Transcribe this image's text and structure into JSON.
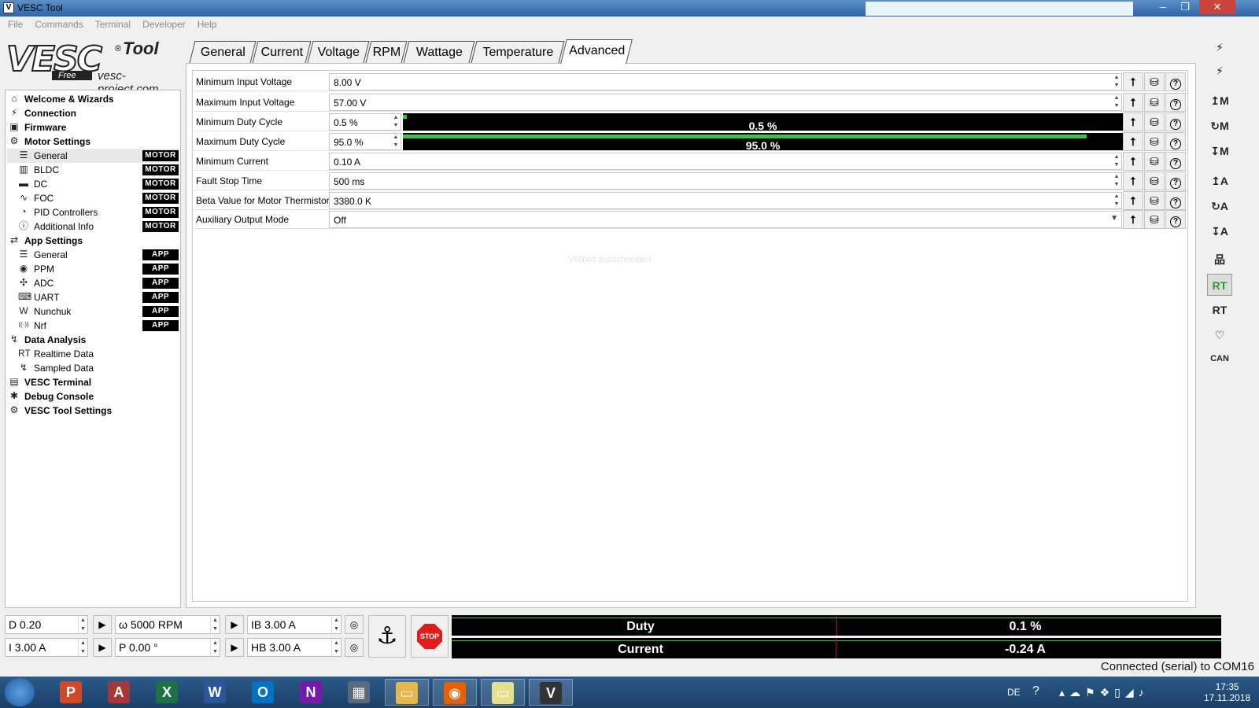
{
  "window": {
    "title": "VESC Tool",
    "icon": "V"
  },
  "menu": [
    "File",
    "Commands",
    "Terminal",
    "Developer",
    "Help"
  ],
  "logo": {
    "brand": "VESC",
    "product": "Tool",
    "reg": "®",
    "edition": "Free",
    "site": "vesc-project.com"
  },
  "tree": [
    {
      "label": "Welcome & Wizards",
      "icon": "home-icon",
      "glyph": "⌂",
      "level": 0
    },
    {
      "label": "Connection",
      "icon": "plug-icon",
      "glyph": "⚡",
      "level": 0
    },
    {
      "label": "Firmware",
      "icon": "chip-icon",
      "glyph": "▣",
      "level": 0
    },
    {
      "label": "Motor Settings",
      "icon": "motor-icon",
      "glyph": "⚙",
      "level": 0
    },
    {
      "label": "General",
      "icon": "sliders-icon",
      "glyph": "☰",
      "level": 1,
      "tag": "MOTOR",
      "selected": true
    },
    {
      "label": "BLDC",
      "icon": "bldc-icon",
      "glyph": "▥",
      "level": 1,
      "tag": "MOTOR"
    },
    {
      "label": "DC",
      "icon": "battery-icon",
      "glyph": "▬",
      "level": 1,
      "tag": "MOTOR"
    },
    {
      "label": "FOC",
      "icon": "coil-icon",
      "glyph": "∿",
      "level": 1,
      "tag": "MOTOR"
    },
    {
      "label": "PID Controllers",
      "icon": "gauge-icon",
      "glyph": "◔",
      "level": 1,
      "tag": "MOTOR"
    },
    {
      "label": "Additional Info",
      "icon": "info-icon",
      "glyph": "ⓘ",
      "level": 1,
      "tag": "MOTOR"
    },
    {
      "label": "App Settings",
      "icon": "swap-icon",
      "glyph": "⇄",
      "level": 0
    },
    {
      "label": "General",
      "icon": "sliders-icon",
      "glyph": "☰",
      "level": 1,
      "tag": "APP"
    },
    {
      "label": "PPM",
      "icon": "gamepad-icon",
      "glyph": "◉",
      "level": 1,
      "tag": "APP"
    },
    {
      "label": "ADC",
      "icon": "adc-icon",
      "glyph": "✣",
      "level": 1,
      "tag": "APP"
    },
    {
      "label": "UART",
      "icon": "keyboard-icon",
      "glyph": "⌨",
      "level": 1,
      "tag": "APP"
    },
    {
      "label": "Nunchuk",
      "icon": "wii-icon",
      "glyph": "W",
      "level": 1,
      "tag": "APP"
    },
    {
      "label": "Nrf",
      "icon": "wireless-icon",
      "glyph": "((·))",
      "level": 1,
      "tag": "APP"
    },
    {
      "label": "Data Analysis",
      "icon": "chart-icon",
      "glyph": "↯",
      "level": 0
    },
    {
      "label": "Realtime Data",
      "icon": "realtime-icon",
      "glyph": "RT",
      "level": 1
    },
    {
      "label": "Sampled Data",
      "icon": "sampled-icon",
      "glyph": "↯",
      "level": 1
    },
    {
      "label": "VESC Terminal",
      "icon": "terminal-icon",
      "glyph": "▤",
      "level": 0
    },
    {
      "label": "Debug Console",
      "icon": "bug-icon",
      "glyph": "✱",
      "level": 0
    },
    {
      "label": "VESC Tool Settings",
      "icon": "gear-icon",
      "glyph": "⚙",
      "level": 0
    }
  ],
  "tabs": [
    "General",
    "Current",
    "Voltage",
    "RPM",
    "Wattage",
    "Temperature",
    "Advanced"
  ],
  "active_tab": "Advanced",
  "params": [
    {
      "label": "Minimum Input Voltage",
      "value": "8.00 V",
      "kind": "spin"
    },
    {
      "label": "Maximum Input Voltage",
      "value": "57.00 V",
      "kind": "spin"
    },
    {
      "label": "Minimum Duty Cycle",
      "value": "0.5 %",
      "kind": "bar",
      "bar_text": "0.5 %",
      "fraction": 0.005
    },
    {
      "label": "Maximum Duty Cycle",
      "value": "95.0 %",
      "kind": "bar",
      "bar_text": "95.0 %",
      "fraction": 0.95
    },
    {
      "label": "Minimum Current",
      "value": "0.10 A",
      "kind": "spin"
    },
    {
      "label": "Fault Stop Time",
      "value": "500 ms",
      "kind": "spin"
    },
    {
      "label": "Beta Value for Motor Thermistor",
      "value": "3380.0 K",
      "kind": "spin"
    },
    {
      "label": "Auxiliary Output Mode",
      "value": "Off",
      "kind": "select"
    }
  ],
  "param_buttons": {
    "upload": "⭡",
    "default": "⛁",
    "help": "?"
  },
  "watermark": "Vollbild ausschneiden",
  "right_toolbar": [
    {
      "name": "connect-icon",
      "glyph": "⚡"
    },
    {
      "name": "disconnect-icon",
      "glyph": "⚡"
    },
    {
      "name": "read-motor-config-icon",
      "glyph": "↥M"
    },
    {
      "name": "read-default-motor-config-icon",
      "glyph": "↻M"
    },
    {
      "name": "write-motor-config-icon",
      "glyph": "↧M"
    },
    {
      "name": "read-app-config-icon",
      "glyph": "↥A"
    },
    {
      "name": "read-default-app-config-icon",
      "glyph": "↻A"
    },
    {
      "name": "write-app-config-icon",
      "glyph": "↧A"
    },
    {
      "name": "can-network-icon",
      "glyph": "品"
    },
    {
      "name": "realtime-data-icon",
      "glyph": "RT",
      "active": true
    },
    {
      "name": "realtime-app-icon",
      "glyph": "RT"
    },
    {
      "name": "heartbeat-icon",
      "glyph": "♡"
    },
    {
      "name": "can-fwd-icon",
      "glyph": "CAN"
    }
  ],
  "controls": {
    "duty": "D 0.20",
    "current": "I 3.00 A",
    "rpm": "ω 5000 RPM",
    "position": "P 0.00 °",
    "brake_current": "IB 3.00 A",
    "handbrake": "HB 3.00 A",
    "play": "▶",
    "brake": "◎",
    "anchor": "⚓",
    "stop": "STOP"
  },
  "gauges": [
    {
      "name": "Duty",
      "value": "0.1 %",
      "fraction": 0.001
    },
    {
      "name": "Current",
      "value": "-0.24 A",
      "fraction": -0.002
    }
  ],
  "status": "Connected (serial) to COM16",
  "taskbar": {
    "apps": [
      {
        "name": "powerpoint-icon",
        "glyph": "P",
        "color": "#d24726"
      },
      {
        "name": "access-icon",
        "glyph": "A",
        "color": "#a4373a"
      },
      {
        "name": "excel-icon",
        "glyph": "X",
        "color": "#1e7145"
      },
      {
        "name": "word-icon",
        "glyph": "W",
        "color": "#2b579a"
      },
      {
        "name": "outlook-icon",
        "glyph": "O",
        "color": "#0072c6"
      },
      {
        "name": "onenote-icon",
        "glyph": "N",
        "color": "#7719aa"
      },
      {
        "name": "calculator-icon",
        "glyph": "▦",
        "color": "#5a6a7a"
      },
      {
        "name": "explorer-icon",
        "glyph": "▭",
        "color": "#e6b84a"
      },
      {
        "name": "firefox-icon",
        "glyph": "◉",
        "color": "#e66000"
      },
      {
        "name": "sticky-notes-icon",
        "glyph": "▭",
        "color": "#e6e08a"
      },
      {
        "name": "vesc-tool-icon",
        "glyph": "V",
        "color": "#333333"
      }
    ],
    "lang": "DE",
    "time": "17:35",
    "date": "17.11.2018"
  }
}
